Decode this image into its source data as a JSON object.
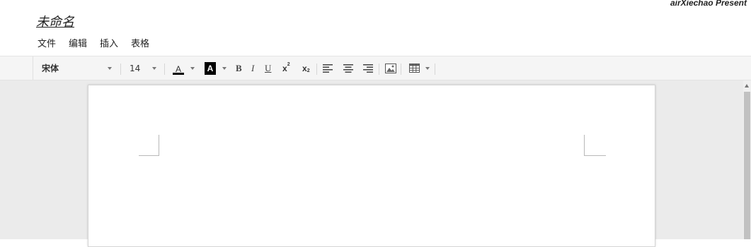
{
  "brand": "airXiechao Present",
  "doc_title": "未命名",
  "menu": [
    "文件",
    "编辑",
    "插入",
    "表格"
  ],
  "toolbar": {
    "font_family_value": "宋体",
    "font_size_value": "14",
    "font_color_glyph": "A",
    "highlight_glyph": "A",
    "bold": "B",
    "italic": "I",
    "underline": "U",
    "superscript_base": "x",
    "superscript_mark": "2",
    "subscript_base": "x",
    "subscript_mark": "2",
    "colors": {
      "font_color": "#000000",
      "highlight": "#000000"
    }
  },
  "icons": {
    "align_left": "align-left-icon",
    "align_center": "align-center-icon",
    "align_right": "align-right-icon",
    "image": "image-icon",
    "table": "table-icon"
  }
}
